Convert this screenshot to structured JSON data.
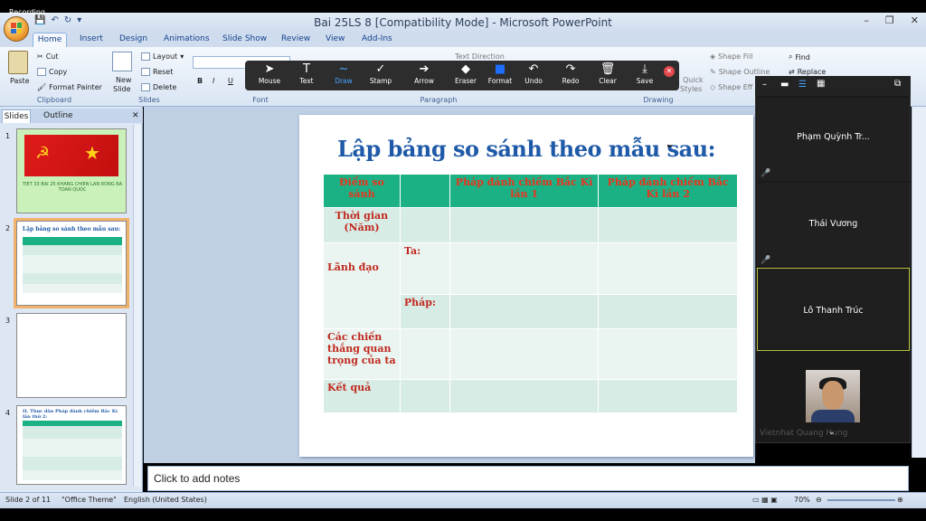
{
  "recording": "Recording",
  "window_title": "Bai 25LS 8 [Compatibility Mode] - Microsoft PowerPoint",
  "ribbon_tabs": [
    "Home",
    "Insert",
    "Design",
    "Animations",
    "Slide Show",
    "Review",
    "View",
    "Add-Ins"
  ],
  "clipboard": {
    "paste": "Paste",
    "cut": "Cut",
    "copy": "Copy",
    "format_painter": "Format Painter",
    "label": "Clipboard"
  },
  "slides_group": {
    "new_slide_1": "New",
    "new_slide_2": "Slide",
    "layout": "Layout",
    "reset": "Reset",
    "delete": "Delete",
    "label": "Slides"
  },
  "font_group": {
    "label": "Font",
    "bold": "B",
    "italic": "I",
    "underline": "U"
  },
  "paragraph_group": {
    "label": "Paragraph",
    "text_direction": "Text Direction"
  },
  "drawing_group": {
    "label": "Drawing",
    "quick_styles_1": "Quick",
    "quick_styles_2": "Styles",
    "shape_fill": "Shape Fill",
    "shape_outline": "Shape Outline",
    "shape_effects": "Shape Eff"
  },
  "editing_group": {
    "find": "Find",
    "replace": "Replace"
  },
  "annotate_toolbar": [
    {
      "glyph": "➤",
      "label": "Mouse"
    },
    {
      "glyph": "T",
      "label": "Text"
    },
    {
      "glyph": "∼",
      "label": "Draw"
    },
    {
      "glyph": "✓",
      "label": "Stamp"
    },
    {
      "glyph": "➔",
      "label": "Arrow"
    },
    {
      "glyph": "◆",
      "label": "Eraser"
    },
    {
      "glyph": "■",
      "label": "Format"
    },
    {
      "glyph": "↶",
      "label": "Undo"
    },
    {
      "glyph": "↷",
      "label": "Redo"
    },
    {
      "glyph": "🗑",
      "label": "Clear"
    },
    {
      "glyph": "⤓",
      "label": "Save"
    }
  ],
  "panel": {
    "slides_tab": "Slides",
    "outline_tab": "Outline"
  },
  "thumbnails": [
    {
      "num": "1",
      "caption": "TIET 33 BAI 25 KHANG CHIEN LAN RONG RA TOAN QUOC"
    },
    {
      "num": "2",
      "caption": "Lập bảng so sánh theo mẫu sau:"
    },
    {
      "num": "3",
      "caption": ""
    },
    {
      "num": "4",
      "caption": "II. Thực dân Pháp đánh chiếm Bắc Kì lần thứ 2:"
    }
  ],
  "slide": {
    "title": "Lập bảng so sánh theo mẫu sau:",
    "header": [
      "Điểm so sánh",
      "",
      "Pháp đánh chiếm Bắc Kì lần 1",
      "Pháp đánh chiếm Bắc Kì lần 2"
    ],
    "rows": [
      {
        "label": "Thời gian (Năm)",
        "sub": ""
      },
      {
        "label": "Lãnh đạo",
        "sub": "Ta:"
      },
      {
        "label": "",
        "sub": "Pháp:"
      },
      {
        "label": "Các chiến thắng quan trọng của ta",
        "sub": ""
      },
      {
        "label": "Kết quả",
        "sub": ""
      }
    ]
  },
  "notes_placeholder": "Click to add notes",
  "status": {
    "slide": "Slide 2 of 11",
    "theme": "\"Office Theme\"",
    "language": "English (United States)",
    "zoom": "70%"
  },
  "participants": [
    {
      "name": "Phạm Quỳnh Tr...",
      "muted": true
    },
    {
      "name": "Thái Vương",
      "muted": true
    },
    {
      "name": "Lô Thanh Trúc",
      "muted": false
    }
  ],
  "video_participant": "Vietnhat Quang Hung"
}
